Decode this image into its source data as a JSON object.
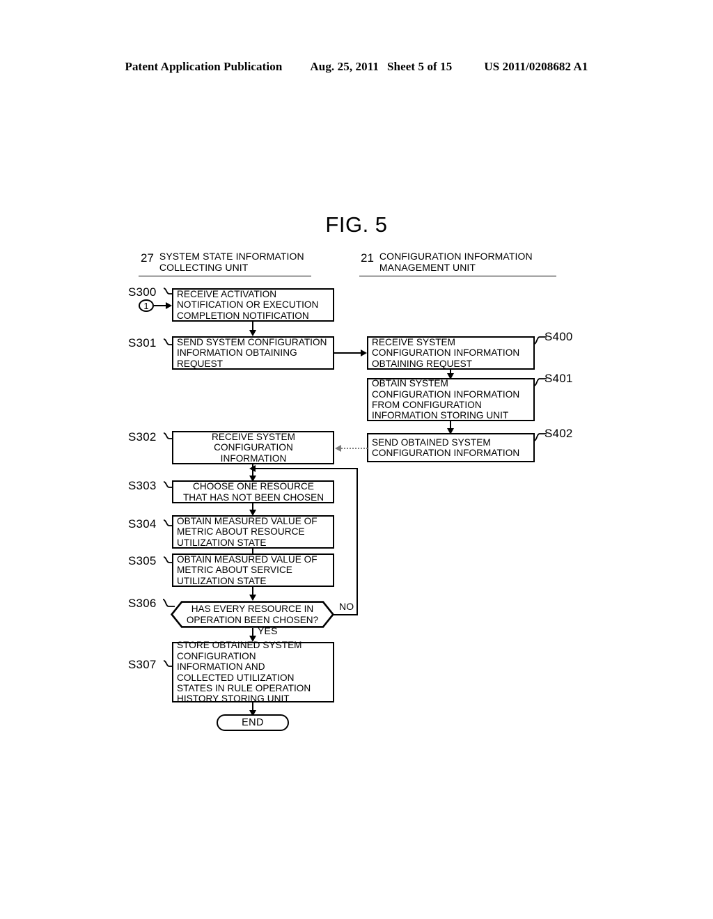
{
  "page_header": {
    "publication": "Patent Application Publication",
    "date": "Aug. 25, 2011",
    "sheet": "Sheet 5 of 15",
    "patent_number": "US 2011/0208682 A1"
  },
  "figure": {
    "title": "FIG. 5"
  },
  "columns": [
    {
      "number": "27",
      "name_line1": "SYSTEM STATE INFORMATION",
      "name_line2": "COLLECTING UNIT"
    },
    {
      "number": "21",
      "name_line1": "CONFIGURATION INFORMATION",
      "name_line2": "MANAGEMENT UNIT"
    }
  ],
  "connector_in": {
    "symbol": "1"
  },
  "steps": {
    "s300": {
      "label": "S300",
      "lines": [
        "RECEIVE ACTIVATION",
        "NOTIFICATION OR EXECUTION",
        "COMPLETION NOTIFICATION"
      ]
    },
    "s301": {
      "label": "S301",
      "lines": [
        "SEND SYSTEM CONFIGURATION",
        "INFORMATION OBTAINING",
        "REQUEST"
      ]
    },
    "s302": {
      "label": "S302",
      "lines": [
        "RECEIVE SYSTEM",
        "CONFIGURATION",
        "INFORMATION"
      ]
    },
    "s303": {
      "label": "S303",
      "lines": [
        "CHOOSE ONE RESOURCE",
        "THAT HAS NOT BEEN CHOSEN"
      ]
    },
    "s304": {
      "label": "S304",
      "lines": [
        "OBTAIN MEASURED VALUE OF",
        "METRIC ABOUT RESOURCE",
        "UTILIZATION STATE"
      ]
    },
    "s305": {
      "label": "S305",
      "lines": [
        "OBTAIN MEASURED VALUE OF",
        "METRIC ABOUT SERVICE",
        "UTILIZATION STATE"
      ]
    },
    "s306": {
      "label": "S306",
      "lines": [
        "HAS EVERY RESOURCE IN",
        "OPERATION BEEN CHOSEN?"
      ],
      "branch_no": "NO",
      "branch_yes": "YES"
    },
    "s307": {
      "label": "S307",
      "lines": [
        "STORE OBTAINED SYSTEM",
        "CONFIGURATION",
        "INFORMATION AND",
        "COLLECTED UTILIZATION",
        "STATES IN RULE OPERATION",
        "HISTORY STORING UNIT"
      ]
    },
    "s400": {
      "label": "S400",
      "lines": [
        "RECEIVE SYSTEM",
        "CONFIGURATION INFORMATION",
        "OBTAINING REQUEST"
      ]
    },
    "s401": {
      "label": "S401",
      "lines": [
        "OBTAIN SYSTEM",
        "CONFIGURATION INFORMATION",
        "FROM CONFIGURATION",
        "INFORMATION STORING UNIT"
      ]
    },
    "s402": {
      "label": "S402",
      "lines": [
        "SEND OBTAINED SYSTEM",
        "CONFIGURATION INFORMATION"
      ]
    }
  },
  "terminator": {
    "end_label": "END"
  }
}
